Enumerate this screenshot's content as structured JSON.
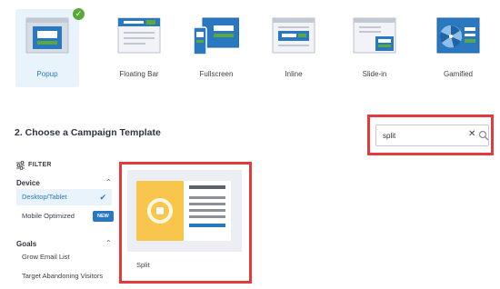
{
  "campaign_types": [
    {
      "label": "Popup",
      "selected": true
    },
    {
      "label": "Floating Bar",
      "selected": false
    },
    {
      "label": "Fullscreen",
      "selected": false
    },
    {
      "label": "Inline",
      "selected": false
    },
    {
      "label": "Slide-in",
      "selected": false
    },
    {
      "label": "Gamified",
      "selected": false
    }
  ],
  "section_heading": "2. Choose a Campaign Template",
  "search": {
    "value": "split"
  },
  "filter": {
    "label": "FILTER",
    "groups": [
      {
        "title": "Device",
        "options": [
          {
            "label": "Desktop/Tablet",
            "active": true
          },
          {
            "label": "Mobile Optimized",
            "badge": "NEW"
          }
        ]
      },
      {
        "title": "Goals",
        "options": [
          {
            "label": "Grow Email List"
          },
          {
            "label": "Target Abandoning Visitors"
          }
        ]
      }
    ]
  },
  "template_card": {
    "name": "Split"
  },
  "colors": {
    "accent": "#2a78c0",
    "highlight_border": "#e33b3b",
    "check_green": "#5aa93a",
    "template_yellow": "#f8c54d",
    "selected_bg": "#e9f3fb"
  }
}
